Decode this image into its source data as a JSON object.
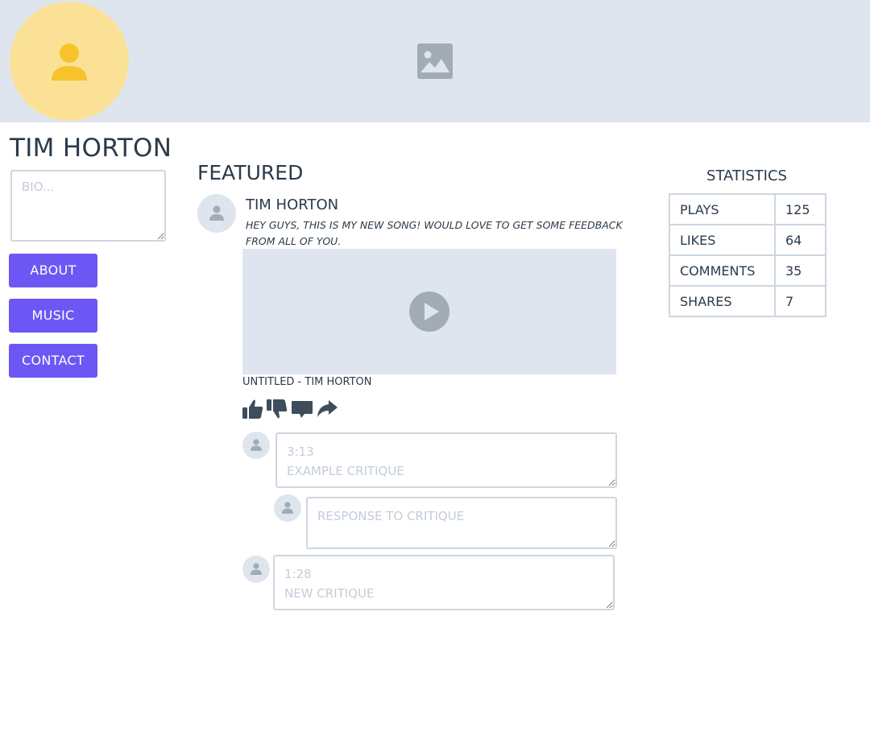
{
  "profile": {
    "name": "TIM HORTON",
    "bio_placeholder": "BIO..."
  },
  "nav": {
    "about": "ABOUT",
    "music": "MUSIC",
    "contact": "CONTACT"
  },
  "featured": {
    "heading": "FEATURED",
    "post": {
      "author": "TIM HORTON",
      "text": "HEY GUYS, THIS IS MY NEW SONG! WOULD LOVE TO GET SOME FEEDBACK FROM ALL OF YOU.",
      "track_title": "UNTITLED - TIM HORTON"
    },
    "actions": [
      "thumbs-up-icon",
      "thumbs-down-icon",
      "comment-icon",
      "share-icon"
    ],
    "critiques": [
      {
        "placeholder": "3:13\nEXAMPLE CRITIQUE"
      },
      {
        "placeholder": "RESPONSE TO CRITIQUE"
      },
      {
        "placeholder": "1:28\nNEW CRITIQUE"
      }
    ]
  },
  "statistics": {
    "title": "STATISTICS",
    "rows": [
      {
        "label": "PLAYS",
        "value": "125"
      },
      {
        "label": "LIKES",
        "value": "64"
      },
      {
        "label": "COMMENTS",
        "value": "35"
      },
      {
        "label": "SHARES",
        "value": "7"
      }
    ]
  },
  "colors": {
    "banner": "#dfe5ee",
    "avatar": "#fbe195",
    "avatar_icon": "#f6c32a",
    "accent": "#6c57f5",
    "text": "#2b3a4a",
    "border": "#cdd6e0"
  }
}
